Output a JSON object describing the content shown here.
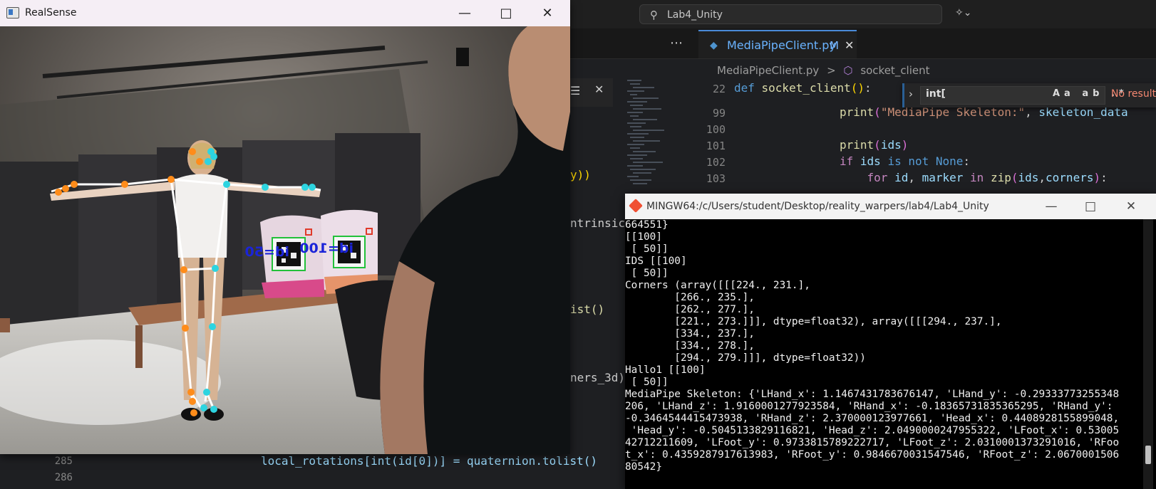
{
  "vscode": {
    "search_text": "Lab4_Unity",
    "tab": {
      "name": "MediaPipeClient.py",
      "status": "M"
    },
    "breadcrumb": [
      "MediaPipeClient.py",
      ">",
      "socket_client"
    ],
    "sticky_line": {
      "number": "22",
      "code": "def socket_client():"
    },
    "lines": [
      {
        "number": "99",
        "code": "print(\"MediaPipe Skeleton:\", skeleton_data"
      },
      {
        "number": "100",
        "code": ""
      },
      {
        "number": "101",
        "code": "print(ids)"
      },
      {
        "number": "102",
        "code": "if ids is not None:"
      },
      {
        "number": "103",
        "code": "    for id, marker in zip(ids,corners):"
      }
    ],
    "left_fragments": [
      "y))",
      "ntrinsic",
      "ist()",
      "ners_3d)"
    ],
    "bottom_lines": [
      {
        "number": "285",
        "code": "local_rotations[int(id[0])] = quaternion.tolist()"
      },
      {
        "number": "286",
        "code": ""
      }
    ],
    "find": {
      "value": "int[",
      "options": "Aa ab .*",
      "result": "No results"
    }
  },
  "realsense": {
    "title": "RealSense",
    "marker_labels": [
      "id=50",
      "id=100"
    ]
  },
  "terminal": {
    "title": "MINGW64:/c/Users/student/Desktop/reality_warpers/lab4/Lab4_Unity",
    "lines": [
      "664551}",
      "[[100]",
      " [ 50]]",
      "IDS [[100]",
      " [ 50]]",
      "Corners (array([[[224., 231.],",
      "        [266., 235.],",
      "        [262., 277.],",
      "        [221., 273.]]], dtype=float32), array([[[294., 237.],",
      "        [334., 237.],",
      "        [334., 278.],",
      "        [294., 279.]]], dtype=float32))",
      "Hallo1 [[100]",
      " [ 50]]",
      "MediaPipe Skeleton: {'LHand_x': 1.1467431783676147, 'LHand_y': -0.29333773255348",
      "206, 'LHand_z': 1.9160001277923584, 'RHand_x': -0.18365731835365295, 'RHand_y':",
      "-0.3464544415473938, 'RHand_z': 2.370000123977661, 'Head_x': 0.4408928155899048,",
      " 'Head_y': -0.5045133829116821, 'Head_z': 2.0490000247955322, 'LFoot_x': 0.53005",
      "42712211609, 'LFoot_y': 0.9733815789222717, 'LFoot_z': 2.0310001373291016, 'RFoo",
      "t_x': 0.4359287917613983, 'RFoot_y': 0.9846670031547546, 'RFoot_z': 2.0670001506",
      "80542}"
    ]
  }
}
